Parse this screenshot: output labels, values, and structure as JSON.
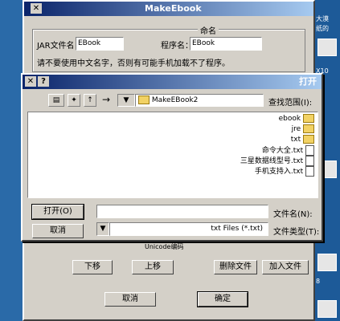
{
  "desktop": {
    "icon_labels": [
      "大漠",
      "纸的",
      "X10",
      "8"
    ]
  },
  "back_dialog": {
    "title": "MakeEbook",
    "name_group_label": "命名",
    "java_name_label": "JAR文件名：",
    "java_name_value": "EBook",
    "program_name_label": "程序名：",
    "program_name_value": "EBook",
    "warning": "请不要使用中文名字，否则有可能手机加载不了程序。",
    "unicode_label": "Unicode编码",
    "buttons": [
      "加入文件",
      "删除文件",
      "上移",
      "下移"
    ],
    "ok_label": "确定",
    "cancel_label": "取消"
  },
  "open_dialog": {
    "title": "打开",
    "help_glyph": "?",
    "close_glyph": "✕",
    "look_in_label": "查找范围(I):",
    "look_in_value": "MakeEBook2",
    "items": [
      {
        "name": "ebook",
        "type": "folder"
      },
      {
        "name": "jre",
        "type": "folder"
      },
      {
        "name": "txt",
        "type": "folder"
      },
      {
        "name": "命令大全.txt",
        "type": "file"
      },
      {
        "name": "三星数据线型号.txt",
        "type": "file"
      },
      {
        "name": "手机支持入.txt",
        "type": "file"
      }
    ],
    "filename_label": "文件名(N):",
    "filename_value": "",
    "filetype_label": "文件类型(T):",
    "filetype_value": "txt Files (*.txt)",
    "open_button": "打开(O)",
    "cancel_button": "取消"
  }
}
